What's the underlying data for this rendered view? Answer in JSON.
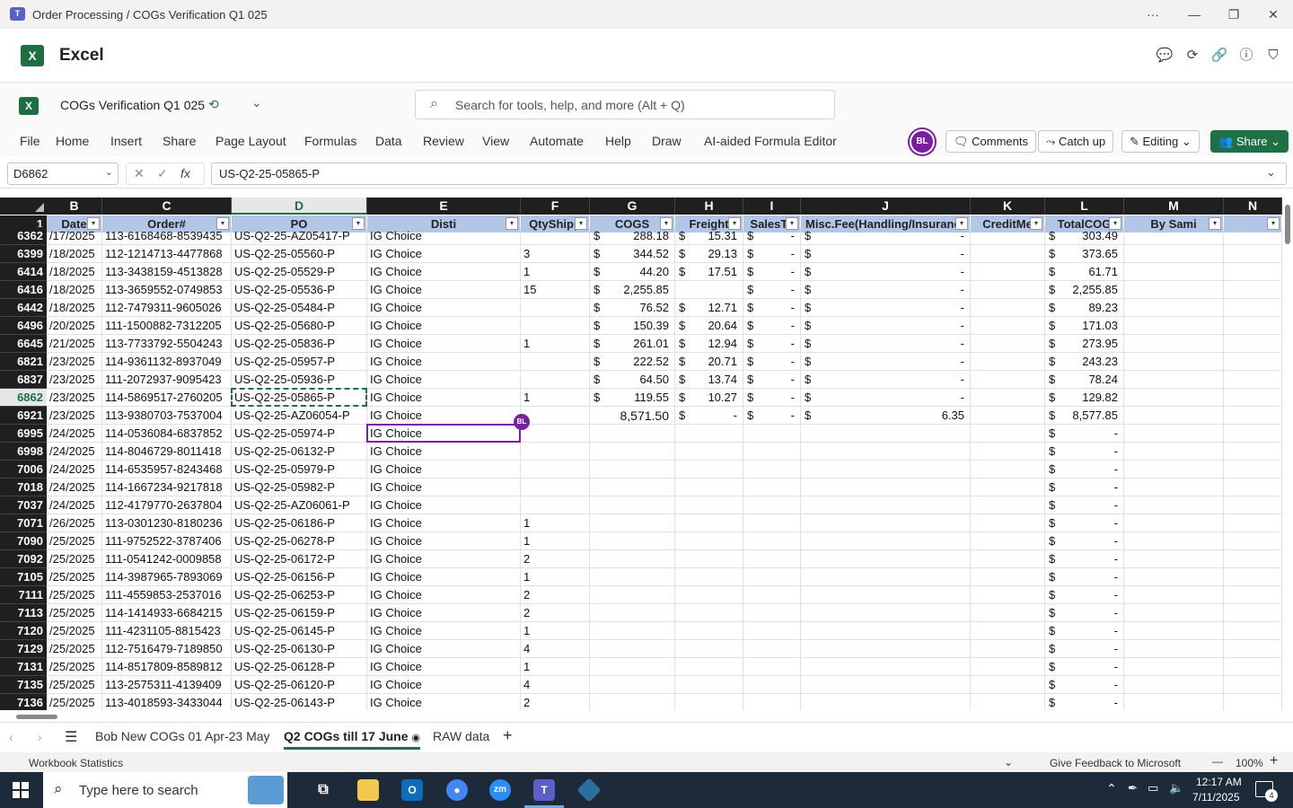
{
  "window": {
    "title": "Order Processing / COGs Verification Q1 025",
    "more": "···",
    "minimize": "—",
    "maximize": "❐",
    "close": "✕"
  },
  "app": {
    "name": "Excel",
    "logo_letter": "X"
  },
  "doc": {
    "name": "COGs Verification Q1 025",
    "chevron": "⌄"
  },
  "search": {
    "placeholder": "Search for tools, help, and more (Alt + Q)"
  },
  "ribbon": {
    "tabs": [
      "File",
      "Home",
      "Insert",
      "Share",
      "Page Layout",
      "Formulas",
      "Data",
      "Review",
      "View",
      "Automate",
      "Help",
      "Draw",
      "AI-aided Formula Editor"
    ],
    "avatar": "BL",
    "comments": "Comments",
    "catchup": "Catch up",
    "editing": "Editing",
    "share": "Share"
  },
  "formula_bar": {
    "name_box": "D6862",
    "formula": "US-Q2-25-05865-P",
    "fx": "fx"
  },
  "columns": [
    "B",
    "C",
    "D",
    "E",
    "F",
    "G",
    "H",
    "I",
    "J",
    "K",
    "L",
    "M",
    "N"
  ],
  "selected_column": "D",
  "header_row": {
    "row_num": "1",
    "cells": [
      "Date",
      "Order#",
      "PO",
      "Disti",
      "QtyShipp",
      "COGS",
      "Freight",
      "SalesTa",
      "Misc.Fee(Handling/Insuranc",
      "CreditMe",
      "TotalCOG",
      "By Sami",
      ""
    ]
  },
  "rows": [
    {
      "n": "6362",
      "date": "/17/2025",
      "order": "113-6168468-8539435",
      "po": "US-Q2-25-AZ05417-P",
      "disti": "IG Choice",
      "qty": "",
      "cogs": "288.18",
      "freight": "15.31",
      "sales": "-",
      "misc": "-",
      "credit": "",
      "total": "303.49"
    },
    {
      "n": "6399",
      "date": "/18/2025",
      "order": "112-1214713-4477868",
      "po": "US-Q2-25-05560-P",
      "disti": "IG Choice",
      "qty": "3",
      "cogs": "344.52",
      "freight": "29.13",
      "sales": "-",
      "misc": "-",
      "credit": "",
      "total": "373.65"
    },
    {
      "n": "6414",
      "date": "/18/2025",
      "order": "113-3438159-4513828",
      "po": "US-Q2-25-05529-P",
      "disti": "IG Choice",
      "qty": "1",
      "cogs": "44.20",
      "freight": "17.51",
      "sales": "-",
      "misc": "-",
      "credit": "",
      "total": "61.71"
    },
    {
      "n": "6416",
      "date": "/18/2025",
      "order": "113-3659552-0749853",
      "po": "US-Q2-25-05536-P",
      "disti": "IG Choice",
      "qty": "15",
      "cogs": "2,255.85",
      "freight": "",
      "sales": "-",
      "misc": "-",
      "credit": "",
      "total": "2,255.85"
    },
    {
      "n": "6442",
      "date": "/18/2025",
      "order": "112-7479311-9605026",
      "po": "US-Q2-25-05484-P",
      "disti": "IG Choice",
      "qty": "",
      "cogs": "76.52",
      "freight": "12.71",
      "sales": "-",
      "misc": "-",
      "credit": "",
      "total": "89.23"
    },
    {
      "n": "6496",
      "date": "/20/2025",
      "order": "111-1500882-7312205",
      "po": "US-Q2-25-05680-P",
      "disti": "IG Choice",
      "qty": "",
      "cogs": "150.39",
      "freight": "20.64",
      "sales": "-",
      "misc": "-",
      "credit": "",
      "total": "171.03"
    },
    {
      "n": "6645",
      "date": "/21/2025",
      "order": "113-7733792-5504243",
      "po": "US-Q2-25-05836-P",
      "disti": "IG Choice",
      "qty": "1",
      "cogs": "261.01",
      "freight": "12.94",
      "sales": "-",
      "misc": "-",
      "credit": "",
      "total": "273.95"
    },
    {
      "n": "6821",
      "date": "/23/2025",
      "order": "114-9361132-8937049",
      "po": "US-Q2-25-05957-P",
      "disti": "IG Choice",
      "qty": "",
      "cogs": "222.52",
      "freight": "20.71",
      "sales": "-",
      "misc": "-",
      "credit": "",
      "total": "243.23"
    },
    {
      "n": "6837",
      "date": "/23/2025",
      "order": "111-2072937-9095423",
      "po": "US-Q2-25-05936-P",
      "disti": "IG Choice",
      "qty": "",
      "cogs": "64.50",
      "freight": "13.74",
      "sales": "-",
      "misc": "-",
      "credit": "",
      "total": "78.24"
    },
    {
      "n": "6862",
      "date": "/23/2025",
      "order": "114-5869517-2760205",
      "po": "US-Q2-25-05865-P",
      "disti": "IG Choice",
      "qty": "1",
      "cogs": "119.55",
      "freight": "10.27",
      "sales": "-",
      "misc": "-",
      "credit": "",
      "total": "129.82"
    },
    {
      "n": "6921",
      "date": "/23/2025",
      "order": "113-9380703-7537004",
      "po": "US-Q2-25-AZ06054-P",
      "disti": "IG Choice",
      "qty": "",
      "cogs_plain": "8,571.50",
      "freight": "-",
      "sales": "-",
      "misc": "6.35",
      "credit": "",
      "total": "8,577.85"
    },
    {
      "n": "6995",
      "date": "/24/2025",
      "order": "114-0536084-6837852",
      "po": "US-Q2-25-05974-P",
      "disti": "IG Choice",
      "qty": "",
      "total": "-"
    },
    {
      "n": "6998",
      "date": "/24/2025",
      "order": "114-8046729-8011418",
      "po": "US-Q2-25-06132-P",
      "disti": "IG Choice",
      "qty": "",
      "total": "-"
    },
    {
      "n": "7006",
      "date": "/24/2025",
      "order": "114-6535957-8243468",
      "po": "US-Q2-25-05979-P",
      "disti": "IG Choice",
      "qty": "",
      "total": "-"
    },
    {
      "n": "7018",
      "date": "/24/2025",
      "order": "114-1667234-9217818",
      "po": "US-Q2-25-05982-P",
      "disti": "IG Choice",
      "qty": "",
      "total": "-"
    },
    {
      "n": "7037",
      "date": "/24/2025",
      "order": "112-4179770-2637804",
      "po": "US-Q2-25-AZ06061-P",
      "disti": "IG Choice",
      "qty": "",
      "total": "-"
    },
    {
      "n": "7071",
      "date": "/26/2025",
      "order": "113-0301230-8180236",
      "po": "US-Q2-25-06186-P",
      "disti": "IG Choice",
      "qty": "1",
      "total": "-"
    },
    {
      "n": "7090",
      "date": "/25/2025",
      "order": "111-9752522-3787406",
      "po": "US-Q2-25-06278-P",
      "disti": "IG Choice",
      "qty": "1",
      "total": "-"
    },
    {
      "n": "7092",
      "date": "/25/2025",
      "order": "111-0541242-0009858",
      "po": "US-Q2-25-06172-P",
      "disti": "IG Choice",
      "qty": "2",
      "total": "-"
    },
    {
      "n": "7105",
      "date": "/25/2025",
      "order": "114-3987965-7893069",
      "po": "US-Q2-25-06156-P",
      "disti": "IG Choice",
      "qty": "1",
      "total": "-"
    },
    {
      "n": "7111",
      "date": "/25/2025",
      "order": "111-4559853-2537016",
      "po": "US-Q2-25-06253-P",
      "disti": "IG Choice",
      "qty": "2",
      "total": "-"
    },
    {
      "n": "7113",
      "date": "/25/2025",
      "order": "114-1414933-6684215",
      "po": "US-Q2-25-06159-P",
      "disti": "IG Choice",
      "qty": "2",
      "total": "-"
    },
    {
      "n": "7120",
      "date": "/25/2025",
      "order": "111-4231105-8815423",
      "po": "US-Q2-25-06145-P",
      "disti": "IG Choice",
      "qty": "1",
      "total": "-"
    },
    {
      "n": "7129",
      "date": "/25/2025",
      "order": "112-7516479-7189850",
      "po": "US-Q2-25-06130-P",
      "disti": "IG Choice",
      "qty": "4",
      "total": "-"
    },
    {
      "n": "7131",
      "date": "/25/2025",
      "order": "114-8517809-8589812",
      "po": "US-Q2-25-06128-P",
      "disti": "IG Choice",
      "qty": "1",
      "total": "-"
    },
    {
      "n": "7135",
      "date": "/25/2025",
      "order": "113-2575311-4139409",
      "po": "US-Q2-25-06120-P",
      "disti": "IG Choice",
      "qty": "4",
      "total": "-"
    },
    {
      "n": "7136",
      "date": "/25/2025",
      "order": "113-4018593-3433044",
      "po": "US-Q2-25-06143-P",
      "disti": "IG Choice",
      "qty": "2",
      "total": "-"
    }
  ],
  "selected_row": "6862",
  "collab_tag": "BL",
  "sheet_tabs": [
    "Bob New COGs 01 Apr-23 May",
    "Q2 COGs till 17 June",
    "RAW data"
  ],
  "active_sheet": "Q2 COGs till 17 June",
  "status": {
    "left": "Workbook Statistics",
    "feedback": "Give Feedback to Microsoft",
    "zoom": "100%",
    "zoom_out": "—",
    "zoom_in": "+"
  },
  "taskbar": {
    "search_placeholder": "Type here to search",
    "time": "12:17 AM",
    "date": "7/11/2025",
    "notif_count": "4"
  },
  "colors": {
    "accent": "#1e7145",
    "header_fill": "#b4c6e7",
    "collab": "#7b1fa2",
    "taskbar": "#1c2a3a"
  }
}
